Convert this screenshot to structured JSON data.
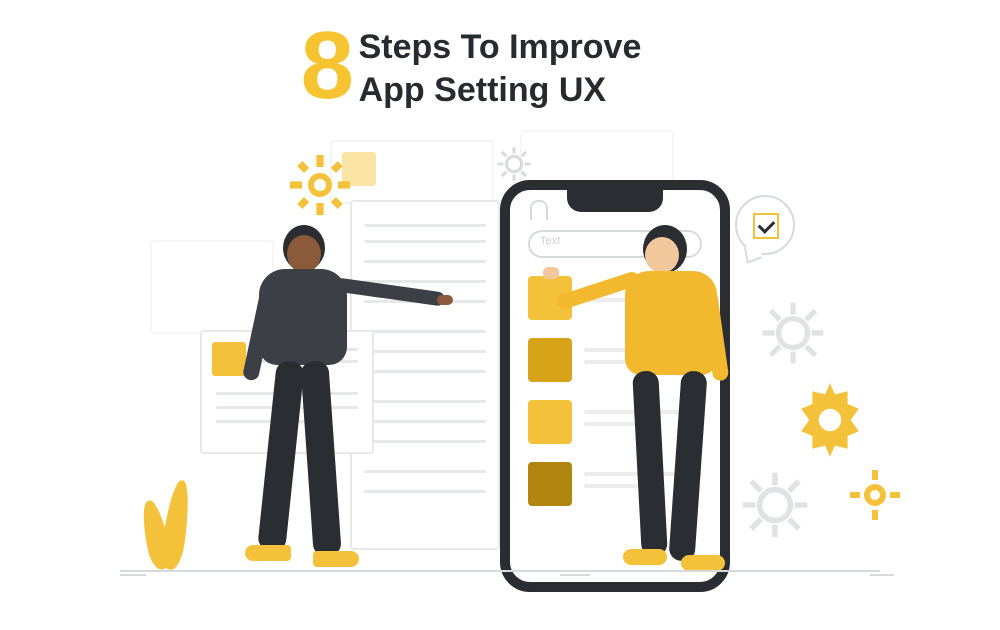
{
  "heading": {
    "number": "8",
    "line1": "Steps To Improve",
    "line2_a": "App ",
    "line2_b": "Setting UX"
  },
  "phone": {
    "placeholder": "Text"
  },
  "colors": {
    "accent": "#f7c431",
    "dark": "#2a2d31",
    "grey": "#d7dadd"
  }
}
